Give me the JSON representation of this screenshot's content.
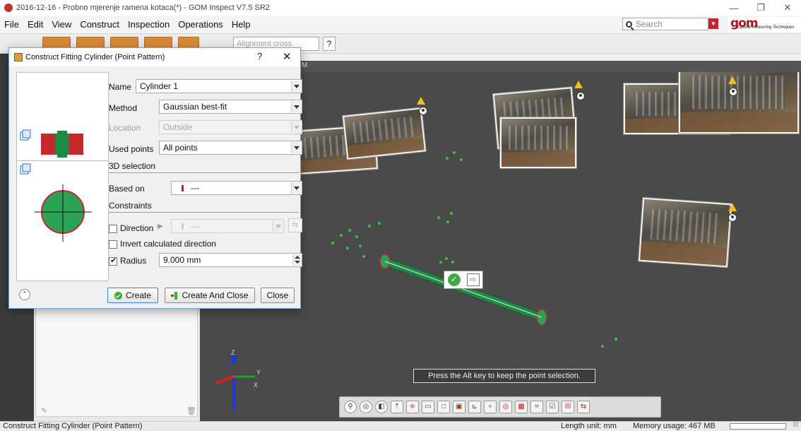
{
  "window": {
    "title": "2016-12-16 - Probno mjerenje ramena kotaca(*) - GOM Inspect V7.5 SR2"
  },
  "menu": [
    "File",
    "Edit",
    "View",
    "Construct",
    "Inspection",
    "Operations",
    "Help"
  ],
  "search": {
    "placeholder": "Search"
  },
  "logo": {
    "main": "gom",
    "tagline": "Optical Measuring Techniques"
  },
  "toolbar": {
    "alignment_combo": "Alignment cross",
    "help_label": "?"
  },
  "viewport": {
    "tab_text": "M",
    "tooltip": "Press the Alt key to keep the point selection."
  },
  "dialog": {
    "title": "Construct Fitting Cylinder (Point Pattern)",
    "help": "?",
    "close": "✕",
    "name": {
      "label": "Name",
      "value": "Cylinder 1"
    },
    "method": {
      "label": "Method",
      "value": "Gaussian best-fit"
    },
    "location": {
      "label": "Location",
      "value": "Outside"
    },
    "used_points": {
      "label": "Used points",
      "value": "All points"
    },
    "section_3d": "3D selection",
    "based_on": {
      "label": "Based on",
      "value": "---"
    },
    "section_constraints": "Constraints",
    "direction": {
      "label": "Direction",
      "value": "---",
      "checked": false
    },
    "invert": {
      "label": "Invert calculated direction",
      "checked": false
    },
    "radius": {
      "label": "Radius",
      "value": "9.000 mm",
      "checked": true
    },
    "buttons": {
      "create": "Create",
      "create_and_close": "Create And Close",
      "close": "Close"
    }
  },
  "statusbar": {
    "left": "Construct Fitting Cylinder (Point Pattern)",
    "length_unit": "Length unit: mm",
    "memory": "Memory usage: 467 MB"
  },
  "colors": {
    "accent": "#c0272d",
    "cylinder": "#1f8a46",
    "viewport_bg": "#4a4a4a",
    "points": "#3ac43a"
  }
}
